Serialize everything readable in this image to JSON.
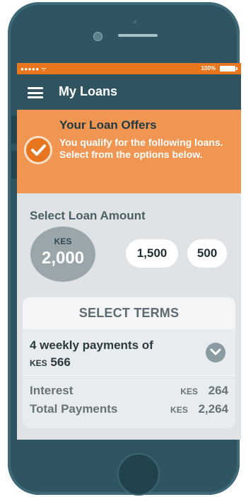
{
  "status_bar": {
    "signal": "●●●●● ᯤ",
    "battery": "100%"
  },
  "nav": {
    "title": "My Loans"
  },
  "offers": {
    "title": "Your Loan Offers",
    "message": "You qualify for the following loans. Select from the options below."
  },
  "amount": {
    "label": "Select Loan Amount",
    "selected_currency": "KES",
    "selected_value": "2,000",
    "options": [
      "1,500",
      "500"
    ]
  },
  "terms": {
    "header": "SELECT TERMS",
    "plan_text": "4 weekly payments of",
    "plan_currency": "KES",
    "plan_amount": "566",
    "interest_label": "Interest",
    "interest_currency": "KES",
    "interest_value": "264",
    "total_label": "Total Payments",
    "total_currency": "KES",
    "total_value": "2,264"
  },
  "colors": {
    "accent": "#e8761e",
    "offers_bg": "#f09652",
    "nav_bg": "#2f5460",
    "phone_body": "#2e5561"
  }
}
